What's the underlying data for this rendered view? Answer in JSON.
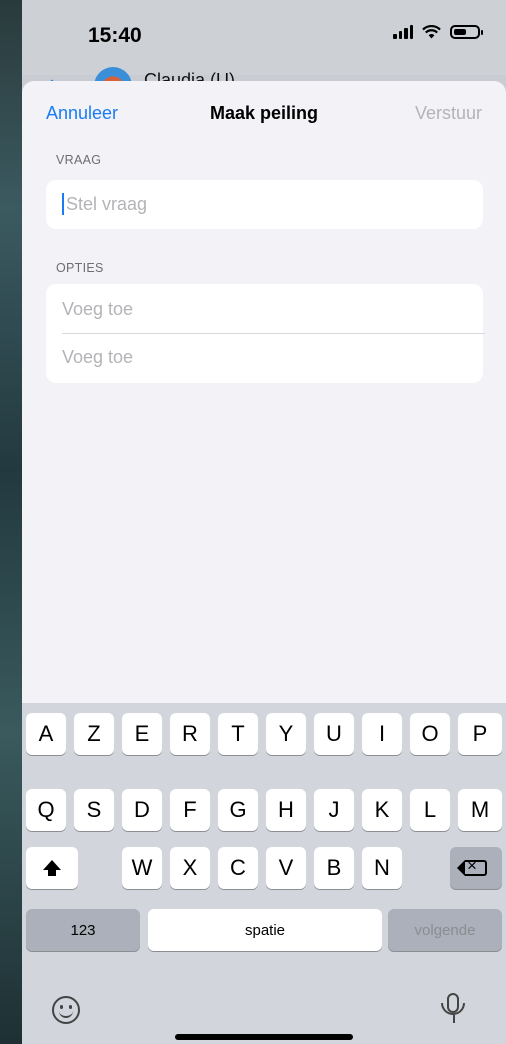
{
  "status_bar": {
    "time": "15:40"
  },
  "chat": {
    "name": "Claudia (U)"
  },
  "nav": {
    "cancel_label": "Annuleer",
    "title": "Maak peiling",
    "send_label": "Verstuur"
  },
  "poll": {
    "question_label": "VRAAG",
    "question_placeholder": "Stel vraag",
    "options_label": "OPTIES",
    "option_placeholders": [
      "Voeg toe",
      "Voeg toe"
    ]
  },
  "keyboard": {
    "row1": [
      "A",
      "Z",
      "E",
      "R",
      "T",
      "Y",
      "U",
      "I",
      "O",
      "P"
    ],
    "row2": [
      "Q",
      "S",
      "D",
      "F",
      "G",
      "H",
      "J",
      "K",
      "L",
      "M"
    ],
    "row3": [
      "W",
      "X",
      "C",
      "V",
      "B",
      "N"
    ],
    "numbers_label": "123",
    "space_label": "spatie",
    "return_label": "volgende"
  }
}
